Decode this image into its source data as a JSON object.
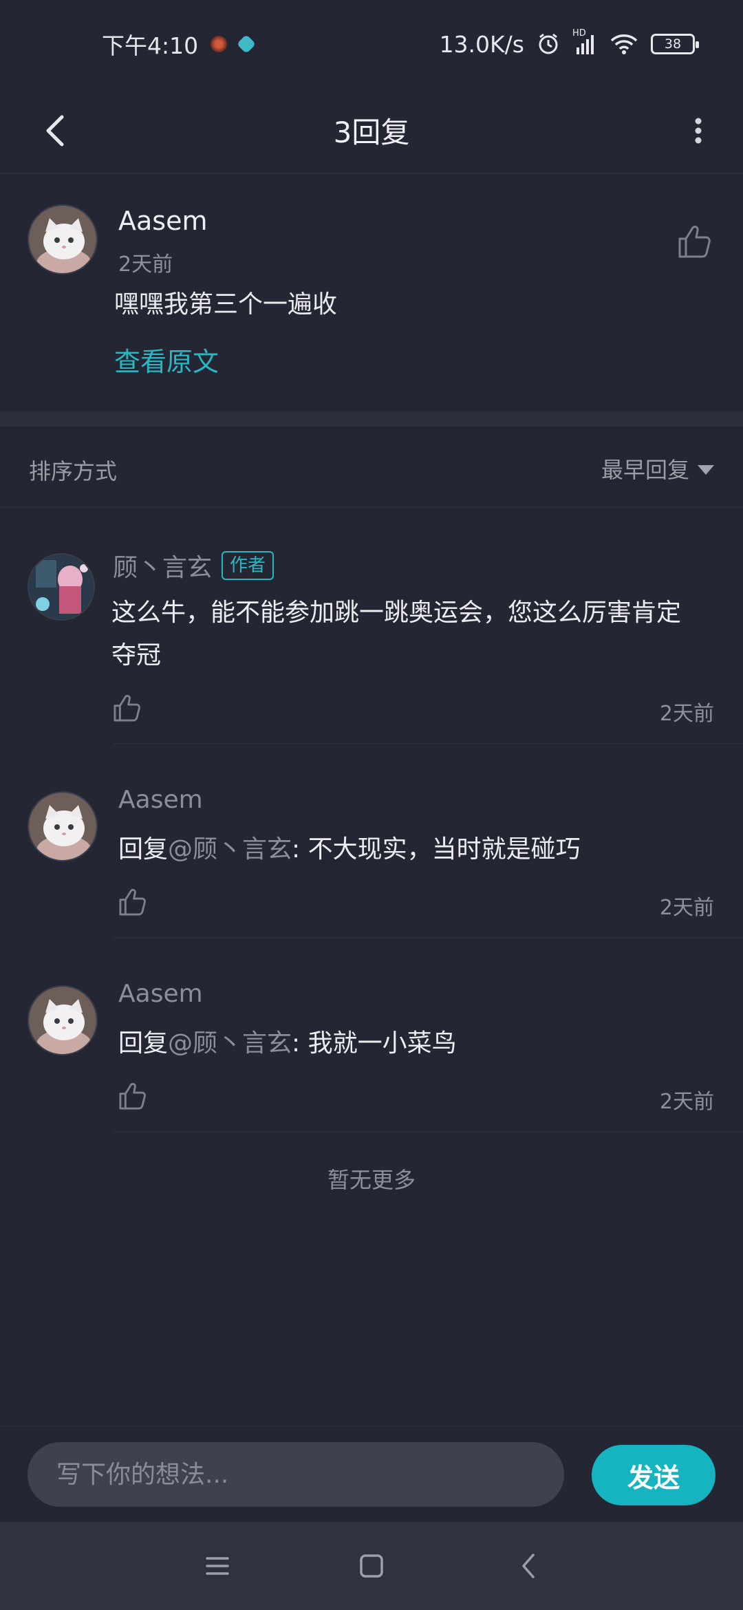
{
  "status_bar": {
    "time": "下午4:10",
    "net_speed": "13.0K/s",
    "hd_label": "HD",
    "battery": "38"
  },
  "header": {
    "title": "3回复"
  },
  "original_post": {
    "author": "Aasem",
    "time": "2天前",
    "text": "嘿嘿我第三个一遍收",
    "view_original_label": "查看原文"
  },
  "sort": {
    "label": "排序方式",
    "selected": "最早回复"
  },
  "replies": [
    {
      "author": "顾丶言玄",
      "badge": "作者",
      "text_line1": "这么牛，能不能参加跳一跳奥运会，您这么厉害肯定",
      "text_line2": "夺冠",
      "time": "2天前"
    },
    {
      "author": "Aasem",
      "reply_prefix": "回复",
      "mention": "@顾丶言玄",
      "text": ": 不大现实，当时就是碰巧",
      "time": "2天前"
    },
    {
      "author": "Aasem",
      "reply_prefix": "回复",
      "mention": "@顾丶言玄",
      "text": ": 我就一小菜鸟",
      "time": "2天前"
    }
  ],
  "footer_text": "暂无更多",
  "composer": {
    "placeholder": "写下你的想法...",
    "send_label": "发送"
  },
  "colors": {
    "background": "#242733",
    "accent": "#16b4c1",
    "link": "#27b8c4"
  }
}
